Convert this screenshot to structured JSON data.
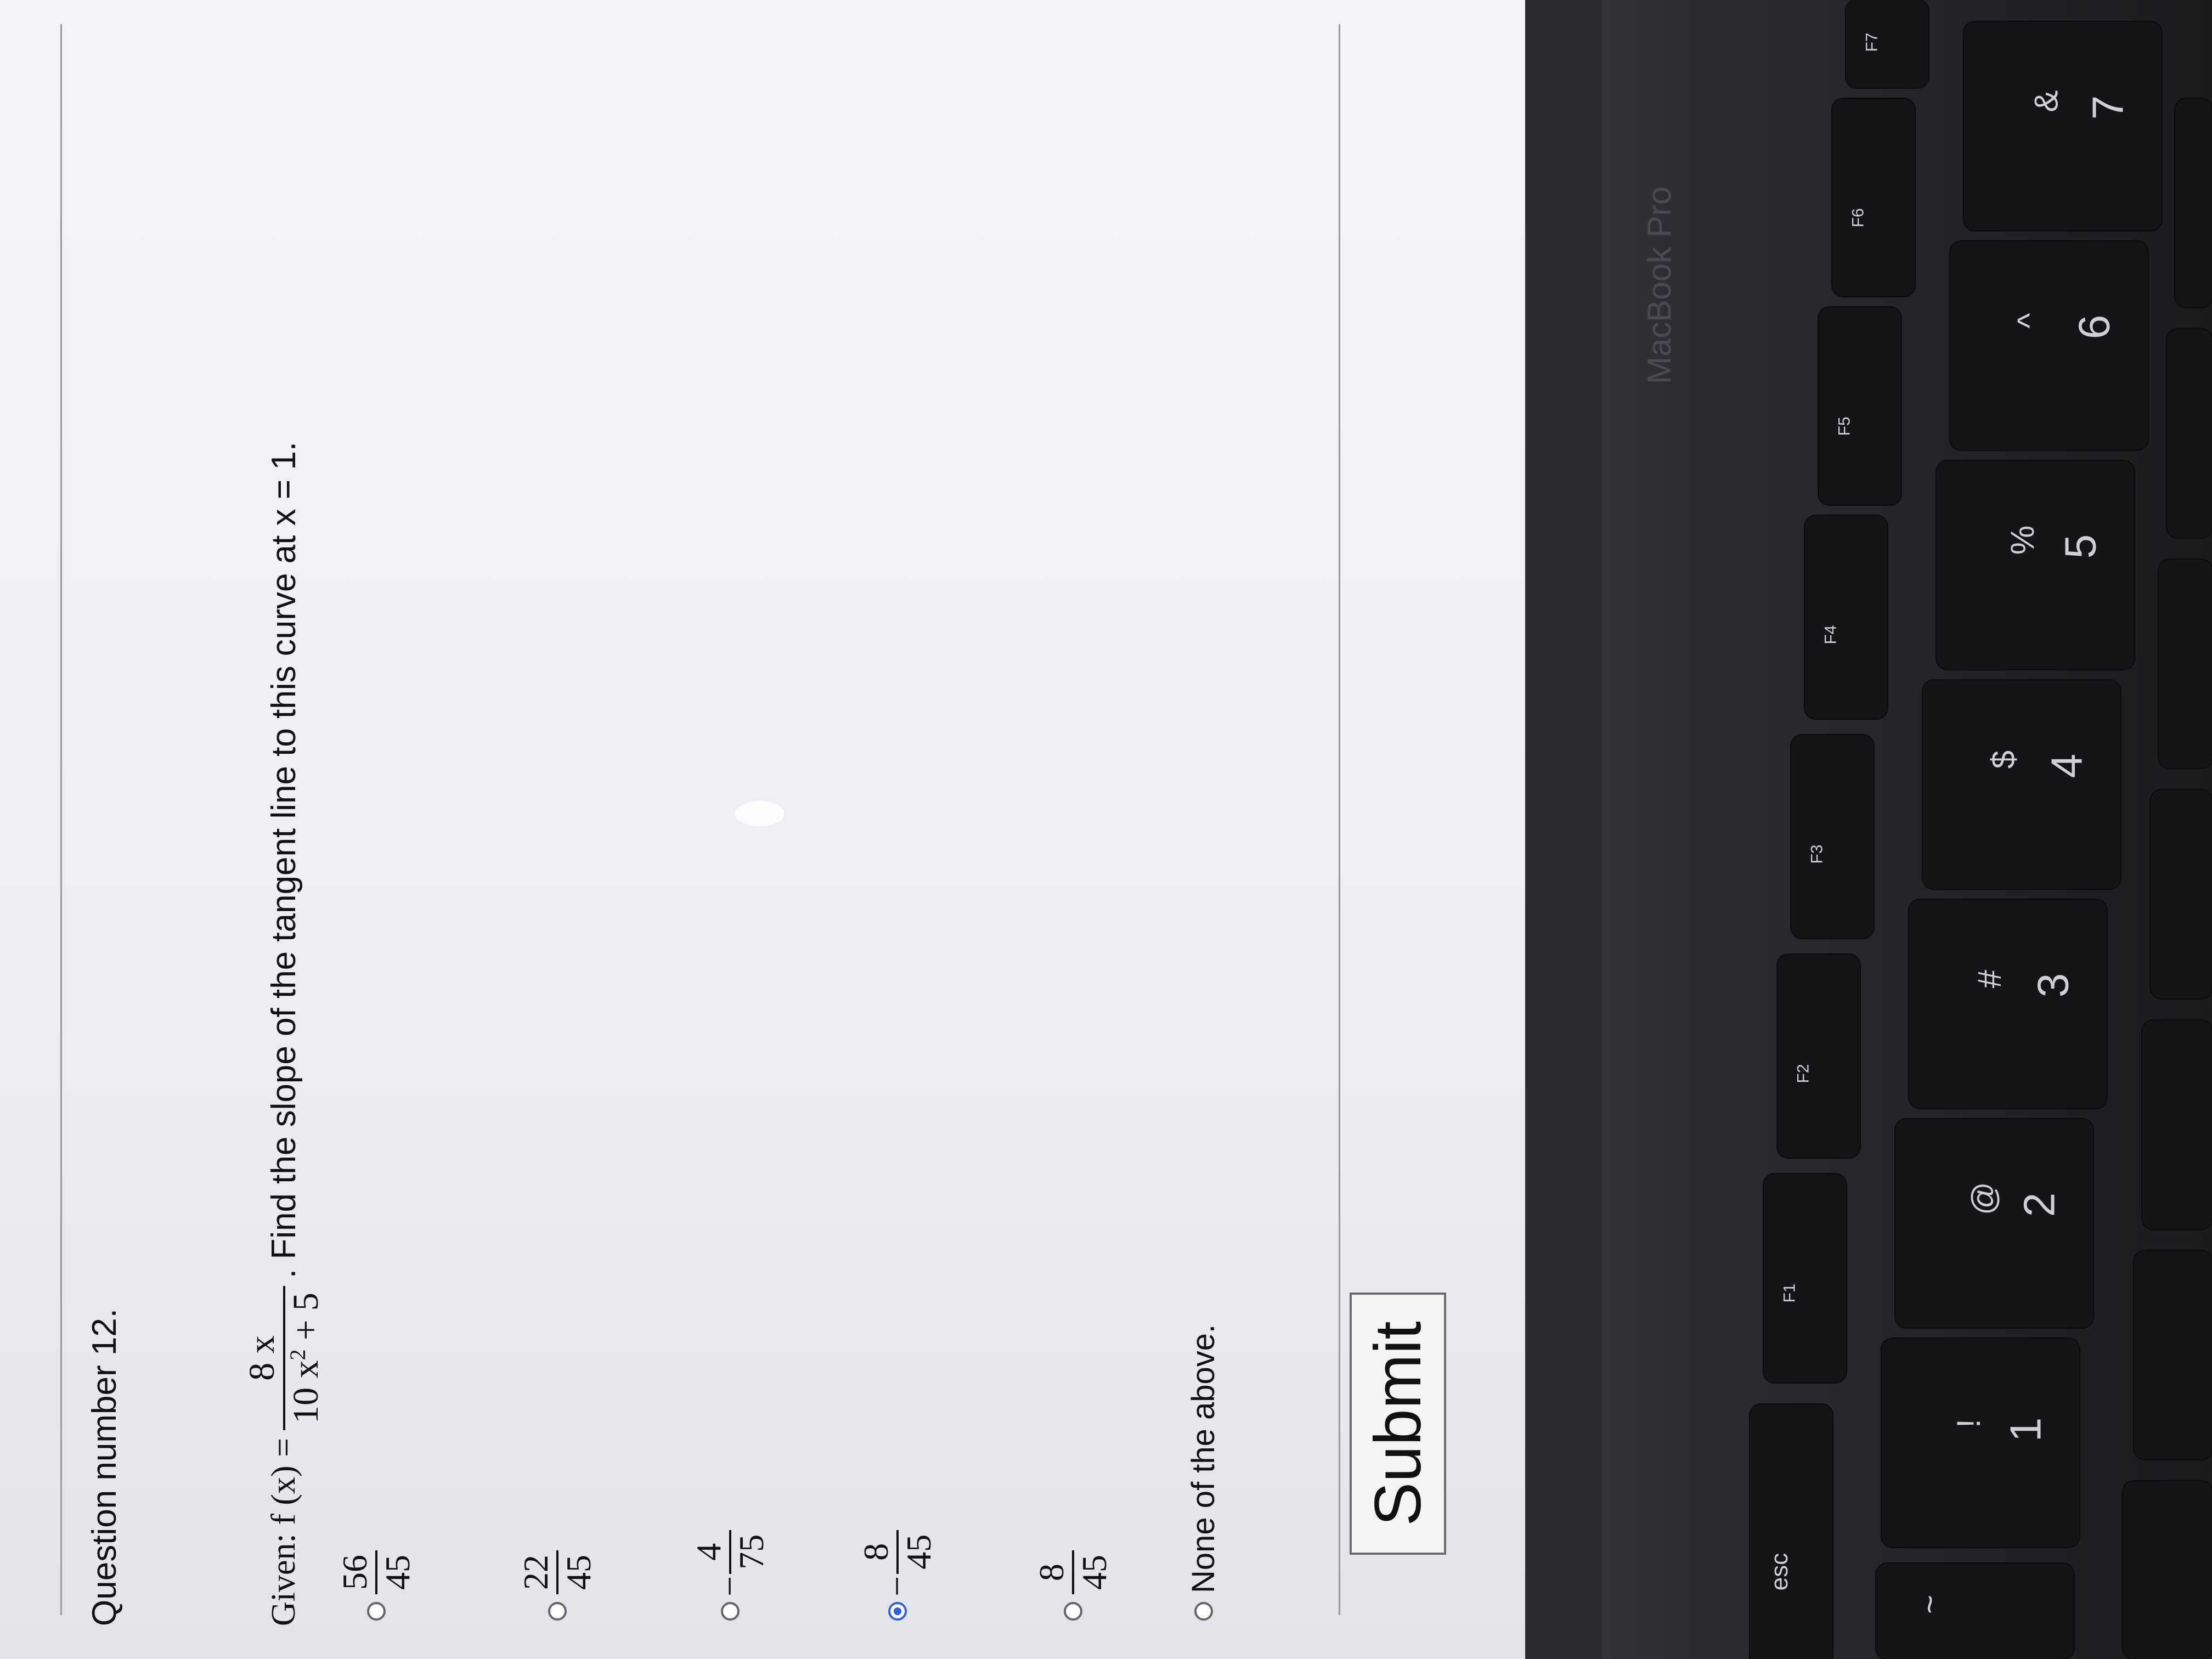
{
  "question": {
    "number_label": "Question number 12.",
    "given_prefix": "Given: f (x) =",
    "function_numerator": "8 x",
    "function_denominator_base": "10 x",
    "function_denominator_exp": "2",
    "function_denominator_tail": " + 5",
    "prompt": ". Find the slope of the tangent line to this curve at x = 1."
  },
  "options": [
    {
      "sign": "",
      "numerator": "56",
      "denominator": "45",
      "selected": false
    },
    {
      "sign": "",
      "numerator": "22",
      "denominator": "45",
      "selected": false
    },
    {
      "sign": "−",
      "numerator": "4",
      "denominator": "75",
      "selected": false
    },
    {
      "sign": "−",
      "numerator": "8",
      "denominator": "45",
      "selected": true
    },
    {
      "sign": "",
      "numerator": "8",
      "denominator": "45",
      "selected": false
    }
  ],
  "none_option": {
    "label": "None of the above.",
    "selected": false
  },
  "submit_label": "Submit",
  "colors": {
    "selected_radio": "#2f62d9",
    "screen_bg": "#f0f1f5"
  },
  "keyboard": {
    "brand": "MacBook Pro",
    "esc": "esc",
    "fkeys": [
      "F1",
      "F2",
      "F3",
      "F4",
      "F5",
      "F6",
      "F7"
    ],
    "number_keys": [
      {
        "top": "!",
        "bottom": "1"
      },
      {
        "top": "@",
        "bottom": "2"
      },
      {
        "top": "#",
        "bottom": "3"
      },
      {
        "top": "$",
        "bottom": "4"
      },
      {
        "top": "%",
        "bottom": "5"
      },
      {
        "top": "^",
        "bottom": "6"
      },
      {
        "top": "&",
        "bottom": "7"
      }
    ],
    "tilde": "~"
  }
}
